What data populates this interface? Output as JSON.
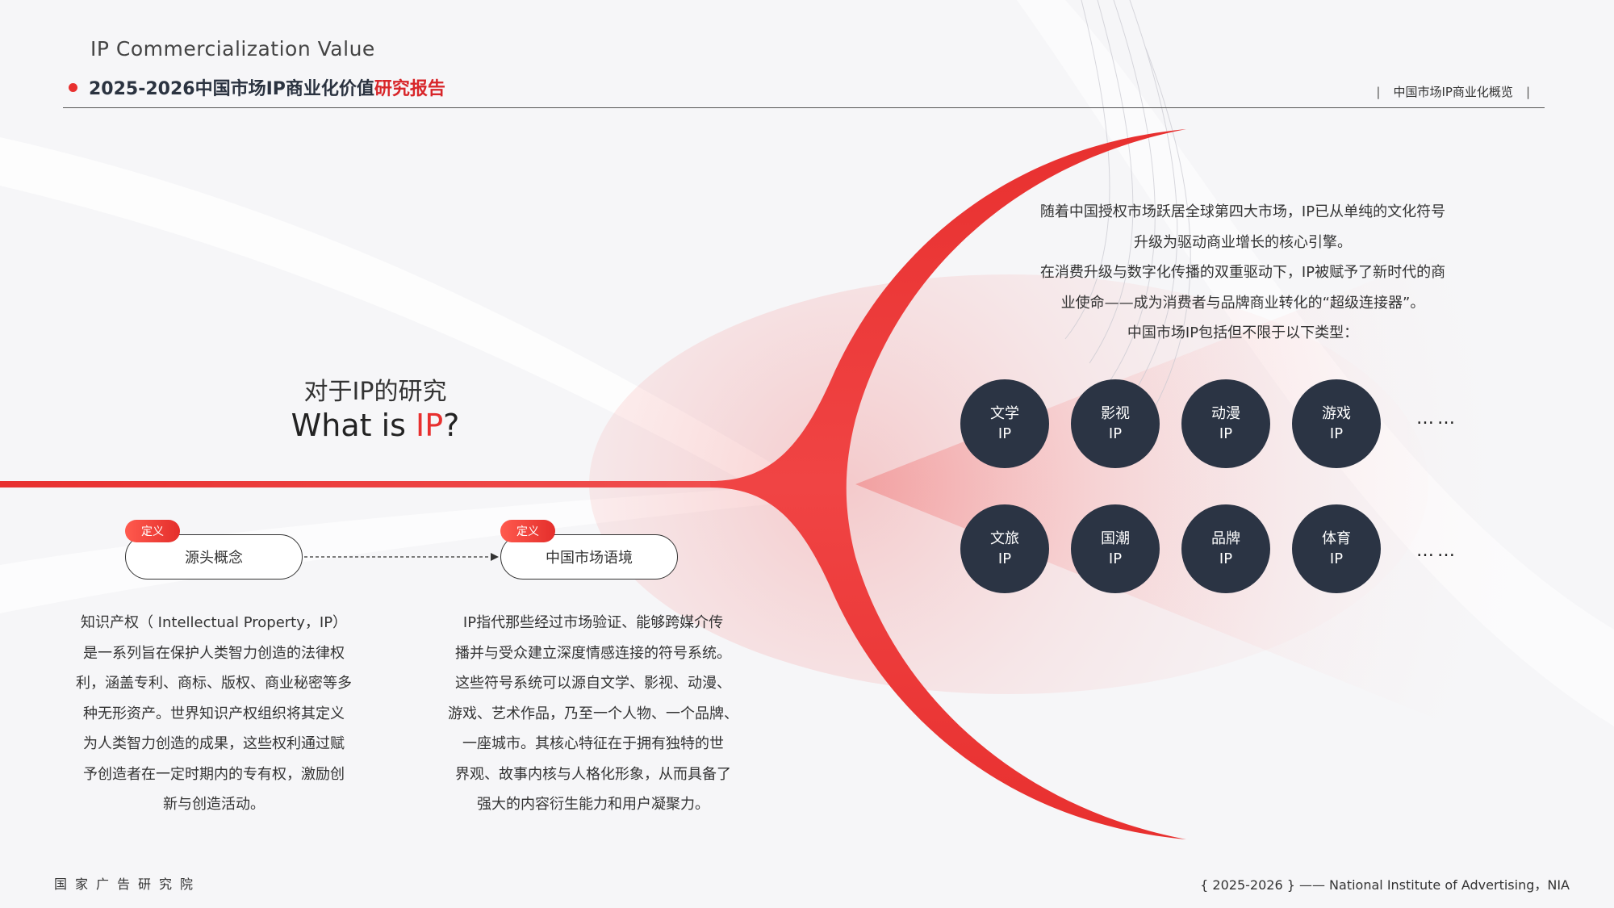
{
  "header": {
    "en_title": "IP Commercialization Value",
    "title_main": "2025-2026中国市场IP商业化价值",
    "title_highlight": "研究报告",
    "section_tag": "中国市场IP商业化概览"
  },
  "question": {
    "cn": "对于IP的研究",
    "en_prefix": "What is ",
    "en_highlight": "IP",
    "en_suffix": "?"
  },
  "definitions": [
    {
      "tag": "定义",
      "label": "源头概念",
      "text": [
        "知识产权（ Intellectual Property，IP）",
        "是一系列旨在保护人类智力创造的法律权",
        "利，涵盖专利、商标、版权、商业秘密等多",
        "种无形资产。世界知识产权组织将其定义",
        "为人类智力创造的成果，这些权利通过赋",
        "予创造者在一定时期内的专有权，激励创",
        "新与创造活动。"
      ]
    },
    {
      "tag": "定义",
      "label": "中国市场语境",
      "text": [
        "IP指代那些经过市场验证、能够跨媒介传",
        "播并与受众建立深度情感连接的符号系统。",
        "这些符号系统可以源自文学、影视、动漫、",
        "游戏、艺术作品，乃至一个人物、一个品牌、",
        "一座城市。其核心特征在于拥有独特的世",
        "界观、故事内核与人格化形象，从而具备了",
        "强大的内容衍生能力和用户凝聚力。"
      ]
    }
  ],
  "intro": [
    "随着中国授权市场跃居全球第四大市场，IP已从单纯的文化符号",
    "升级为驱动商业增长的核心引擎。",
    "在消费升级与数字化传播的双重驱动下，IP被赋予了新时代的商",
    "业使命——成为消费者与品牌商业转化的“超级连接器”。",
    "中国市场IP包括但不限于以下类型："
  ],
  "ip_types": [
    {
      "line1": "文学",
      "line2": "IP"
    },
    {
      "line1": "影视",
      "line2": "IP"
    },
    {
      "line1": "动漫",
      "line2": "IP"
    },
    {
      "line1": "游戏",
      "line2": "IP"
    },
    {
      "line1": "文旅",
      "line2": "IP"
    },
    {
      "line1": "国潮",
      "line2": "IP"
    },
    {
      "line1": "品牌",
      "line2": "IP"
    },
    {
      "line1": "体育",
      "line2": "IP"
    }
  ],
  "ellipsis": "……",
  "footer": {
    "left": "国家广告研究院",
    "right": "{ 2025-2026 } —— National Institute of Advertising，NIA"
  },
  "colors": {
    "accent_red": "#e8302f",
    "circle_navy": "#2b3444",
    "text_dark": "#333333"
  }
}
